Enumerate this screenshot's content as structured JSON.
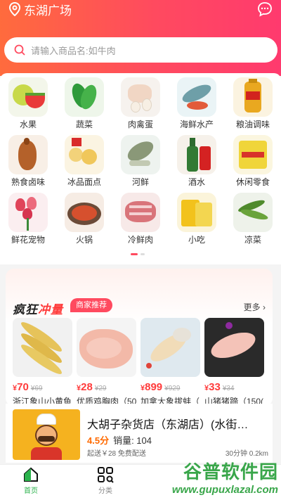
{
  "header": {
    "location": "东湖广场",
    "search_placeholder": "请输入商品名:如牛肉"
  },
  "categories": [
    {
      "label": "水果",
      "icon": "fruit-icon"
    },
    {
      "label": "蔬菜",
      "icon": "vegetable-icon"
    },
    {
      "label": "肉禽蛋",
      "icon": "meat-egg-icon"
    },
    {
      "label": "海鲜水产",
      "icon": "seafood-icon"
    },
    {
      "label": "粮油调味",
      "icon": "oil-grain-icon"
    },
    {
      "label": "熟食卤味",
      "icon": "cooked-duck-icon"
    },
    {
      "label": "冰品面点",
      "icon": "frozen-dessert-icon"
    },
    {
      "label": "河鲜",
      "icon": "river-fish-icon"
    },
    {
      "label": "酒水",
      "icon": "beverage-bottle-icon"
    },
    {
      "label": "休闲零食",
      "icon": "snack-icon"
    },
    {
      "label": "鲜花宠物",
      "icon": "flower-icon"
    },
    {
      "label": "火锅",
      "icon": "hotpot-icon"
    },
    {
      "label": "冷鲜肉",
      "icon": "chilled-meat-icon"
    },
    {
      "label": "小吃",
      "icon": "snack-bag-icon"
    },
    {
      "label": "凉菜",
      "icon": "cold-dish-icon"
    }
  ],
  "promo": {
    "title_a": "疯狂",
    "title_b": "冲量",
    "tag": "商家推荐",
    "more": "更多",
    "goods": [
      {
        "price": "70",
        "old": "69",
        "name": "浙江象山小黄鱼"
      },
      {
        "price": "28",
        "old": "29",
        "name": "优质鸡胸肉（50"
      },
      {
        "price": "899",
        "old": "929",
        "name": "加拿大象拔蚌（"
      },
      {
        "price": "33",
        "old": "34",
        "name": "山猪猪蹄（150("
      }
    ],
    "currency": "¥"
  },
  "shop": {
    "name": "大胡子杂货店（东湖店）(水街…",
    "score": "4.5分",
    "sales": "销量: 104",
    "delivery": "起送￥28 免费配送",
    "distance": "30分钟 0.2km"
  },
  "tabbar": {
    "home": "首页",
    "category": "分类"
  },
  "watermark": {
    "line1": "谷普软件园",
    "line2": "www.gupuxlazal.com"
  },
  "colors": {
    "brand": "#ff4a5f",
    "price": "#ff3b3b",
    "accent_green": "#39a64a"
  }
}
